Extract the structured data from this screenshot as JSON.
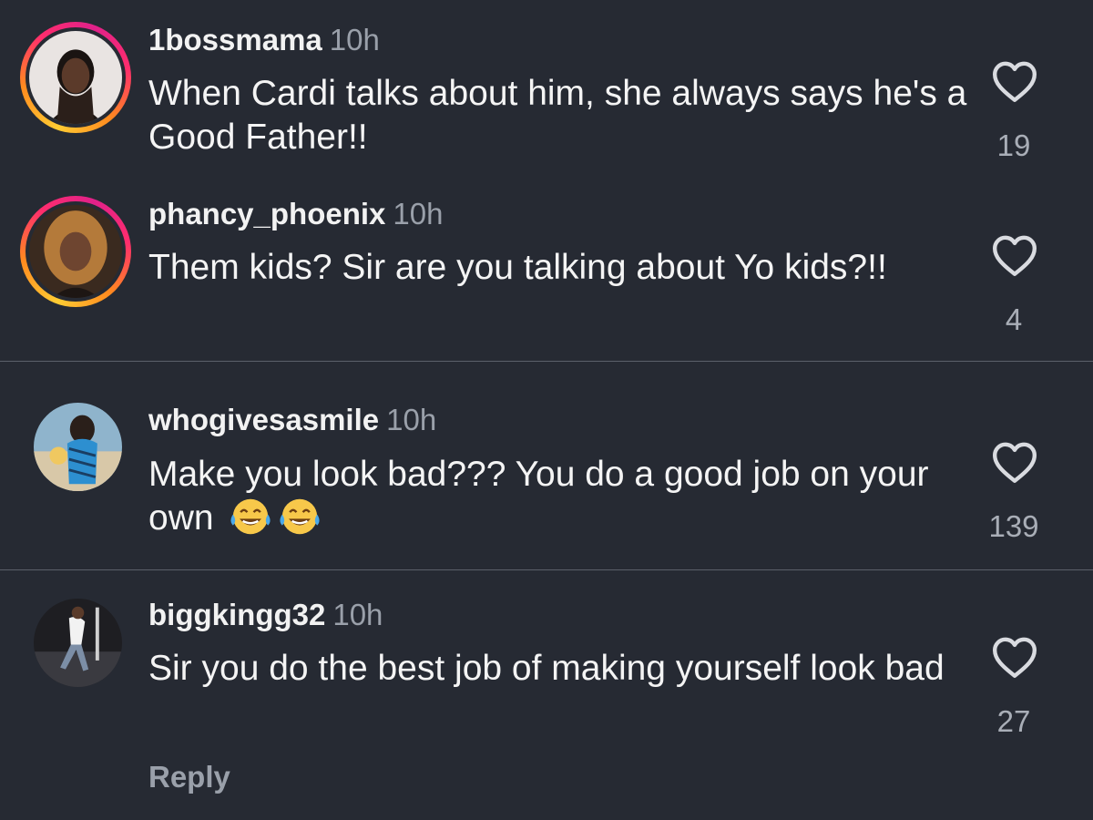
{
  "comments": [
    {
      "username": "1bossmama",
      "time": "10h",
      "text": "When Cardi talks about him, she always says he's a Good Father!!",
      "likes": "19",
      "has_story_ring": true
    },
    {
      "username": "phancy_phoenix",
      "time": "10h",
      "text": "Them kids? Sir are you talking about Yo kids?!!",
      "likes": "4",
      "has_story_ring": true
    },
    {
      "username": "whogivesasmile",
      "time": "10h",
      "text": "Make you look bad??? You do a good job on your own",
      "emoji": [
        "face-with-tears-of-joy",
        "face-with-tears-of-joy"
      ],
      "likes": "139",
      "has_story_ring": false
    },
    {
      "username": "biggkingg32",
      "time": "10h",
      "text": "Sir you do the best job of making yourself look bad",
      "likes": "27",
      "has_story_ring": false
    }
  ],
  "reply_label": "Reply",
  "colors": {
    "background": "#262a33",
    "text": "#f2f2f2",
    "muted": "#9aa0aa",
    "divider": "#5b606a",
    "ring_start": "#ffcc33",
    "ring_end": "#e0218a"
  }
}
